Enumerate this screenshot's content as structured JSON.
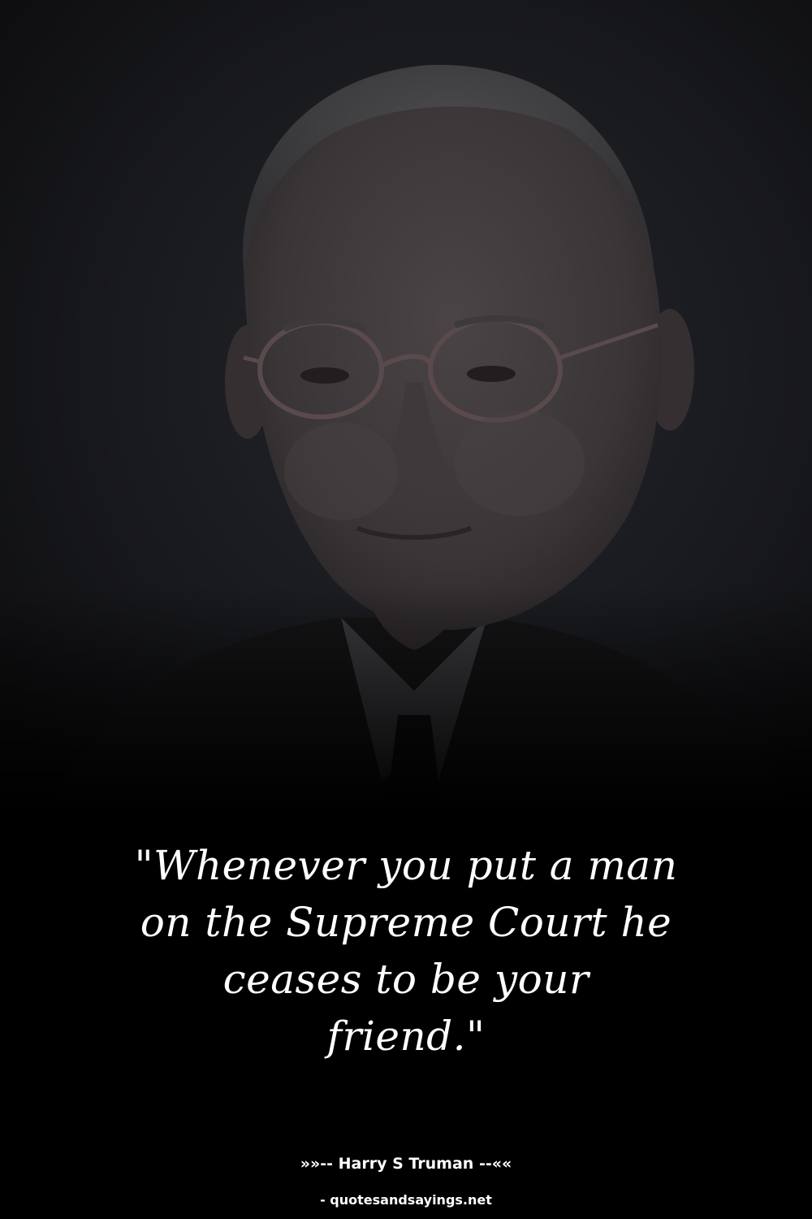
{
  "quote": {
    "lines": [
      "\"Whenever you put a man",
      "on the Supreme Court he",
      "ceases to be your",
      "friend.\""
    ]
  },
  "attribution": {
    "author_line": "»»-- Harry S Truman --««"
  },
  "footer": {
    "site": "- quotesandsayings.net"
  },
  "colors": {
    "background": "#000000",
    "text": "#ffffff",
    "portrait_backdrop": "#1c1d21"
  },
  "image": {
    "subject": "portrait photograph of an elderly man wearing round glasses, dark suit and tie"
  }
}
